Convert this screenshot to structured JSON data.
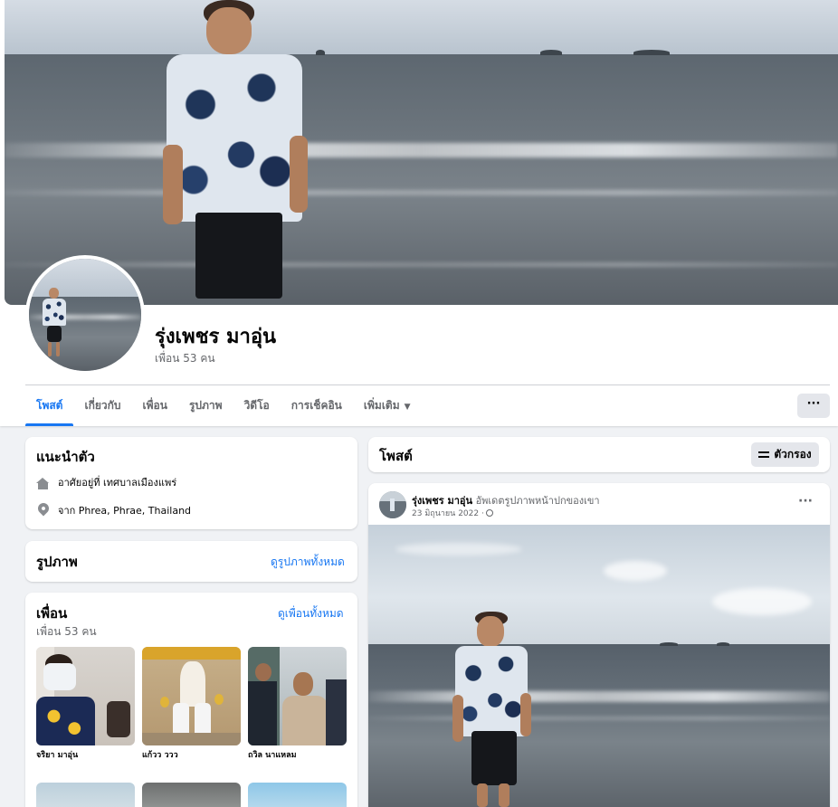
{
  "profile": {
    "name": "รุ่งเพชร มาอุ่น",
    "friends_count": "เพื่อน 53 คน"
  },
  "tabs": [
    {
      "label": "โพสต์",
      "active": true
    },
    {
      "label": "เกี่ยวกับ"
    },
    {
      "label": "เพื่อน"
    },
    {
      "label": "รูปภาพ"
    },
    {
      "label": "วิดีโอ"
    },
    {
      "label": "การเช็คอิน"
    },
    {
      "label": "เพิ่มเติม"
    }
  ],
  "more_button": "···",
  "intro": {
    "title": "แนะนำตัว",
    "lives_in": "อาศัยอยู่ที่ เทศบาลเมืองแพร่",
    "from": "จาก Phrea, Phrae, Thailand"
  },
  "photos": {
    "title": "รูปภาพ",
    "see_all": "ดูรูปภาพทั้งหมด"
  },
  "friends": {
    "title": "เพื่อน",
    "count": "เพื่อน 53 คน",
    "see_all": "ดูเพื่อนทั้งหมด",
    "list": [
      {
        "name": "จริยา มาอุ่น"
      },
      {
        "name": "แก้วว ววว"
      },
      {
        "name": "ถวิล นาแหลม"
      }
    ]
  },
  "posts_panel": {
    "title": "โพสต์",
    "filter_label": "ตัวกรอง"
  },
  "post": {
    "author": "รุ่งเพชร มาอุ่น",
    "action": "อัพเดตรูปภาพหน้าปกของเขา",
    "date": "23 มิถุนายน 2022 ·",
    "menu": "···"
  },
  "colors": {
    "accent": "#1877f2",
    "page_bg": "#f0f2f5",
    "secondary_text": "#65676b"
  }
}
